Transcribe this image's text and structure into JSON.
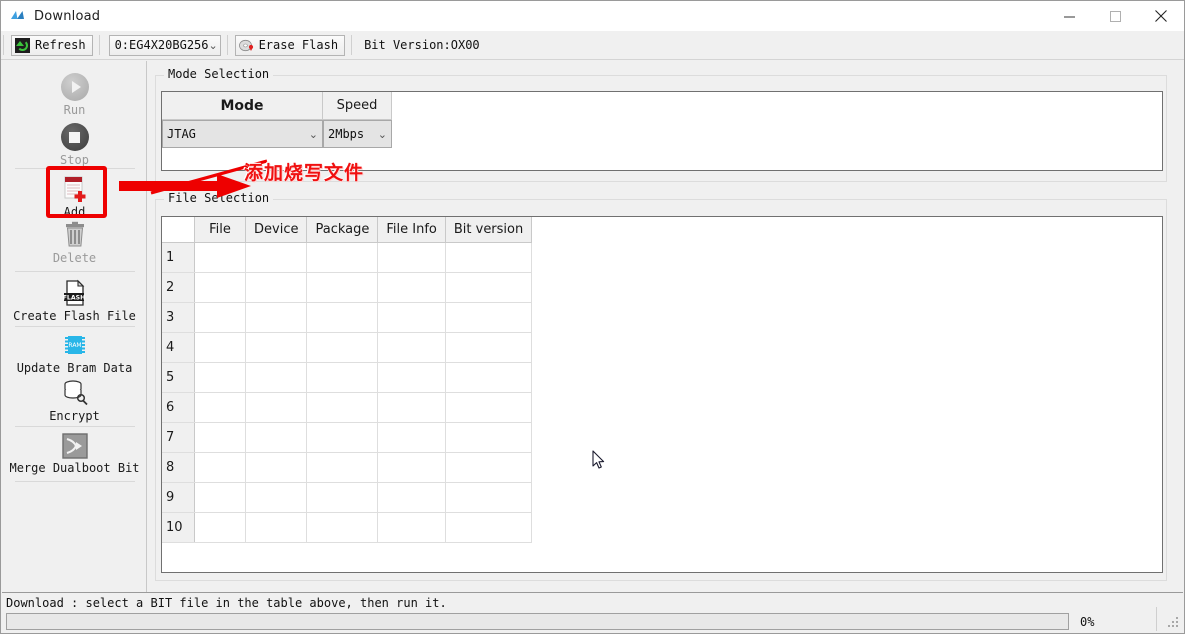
{
  "window": {
    "title": "Download",
    "icon": "app-logo-icon",
    "controls": [
      {
        "name": "minimize",
        "glyph": "—"
      },
      {
        "name": "maximize",
        "glyph": "□"
      },
      {
        "name": "close",
        "glyph": "✕"
      }
    ]
  },
  "toolbar": {
    "refresh_label": "Refresh",
    "device_combo_value": "0:EG4X20BG256",
    "erase_flash_label": "Erase Flash",
    "bit_version_text": "Bit Version:OX00"
  },
  "sidebar": {
    "items": [
      {
        "label": "Run",
        "icon": "run-icon",
        "enabled": false
      },
      {
        "label": "Stop",
        "icon": "stop-icon",
        "enabled": false
      },
      {
        "label": "Add",
        "icon": "add-file-icon",
        "enabled": true
      },
      {
        "label": "Delete",
        "icon": "trash-icon",
        "enabled": false
      },
      {
        "label": "Create Flash File",
        "icon": "flash-file-icon",
        "enabled": true
      },
      {
        "label": "Update Bram Data",
        "icon": "bram-chip-icon",
        "enabled": true
      },
      {
        "label": "Encrypt",
        "icon": "database-key-icon",
        "enabled": true
      },
      {
        "label": "Merge Dualboot Bit",
        "icon": "merge-arrow-icon",
        "enabled": true
      }
    ]
  },
  "annotation": {
    "text": "添加烧写文件",
    "color": "#f01010"
  },
  "mode_selection": {
    "group_title": "Mode Selection",
    "headers": {
      "mode": "Mode",
      "speed": "Speed"
    },
    "mode_value": "JTAG",
    "speed_value": "2Mbps"
  },
  "file_selection": {
    "group_title": "File Selection",
    "columns": [
      "File",
      "Device",
      "Package",
      "File Info",
      "Bit version"
    ],
    "rows": [
      {
        "num": "1",
        "cells": [
          "",
          "",
          "",
          "",
          ""
        ]
      },
      {
        "num": "2",
        "cells": [
          "",
          "",
          "",
          "",
          ""
        ]
      },
      {
        "num": "3",
        "cells": [
          "",
          "",
          "",
          "",
          ""
        ]
      },
      {
        "num": "4",
        "cells": [
          "",
          "",
          "",
          "",
          ""
        ]
      },
      {
        "num": "5",
        "cells": [
          "",
          "",
          "",
          "",
          ""
        ]
      },
      {
        "num": "6",
        "cells": [
          "",
          "",
          "",
          "",
          ""
        ]
      },
      {
        "num": "7",
        "cells": [
          "",
          "",
          "",
          "",
          ""
        ]
      },
      {
        "num": "8",
        "cells": [
          "",
          "",
          "",
          "",
          ""
        ]
      },
      {
        "num": "9",
        "cells": [
          "",
          "",
          "",
          "",
          ""
        ]
      },
      {
        "num": "10",
        "cells": [
          "",
          "",
          "",
          "",
          ""
        ]
      }
    ]
  },
  "statusbar": {
    "message": "Download : select a BIT file in the table above, then run it.",
    "progress_percent": "0%",
    "progress_value": 0
  }
}
